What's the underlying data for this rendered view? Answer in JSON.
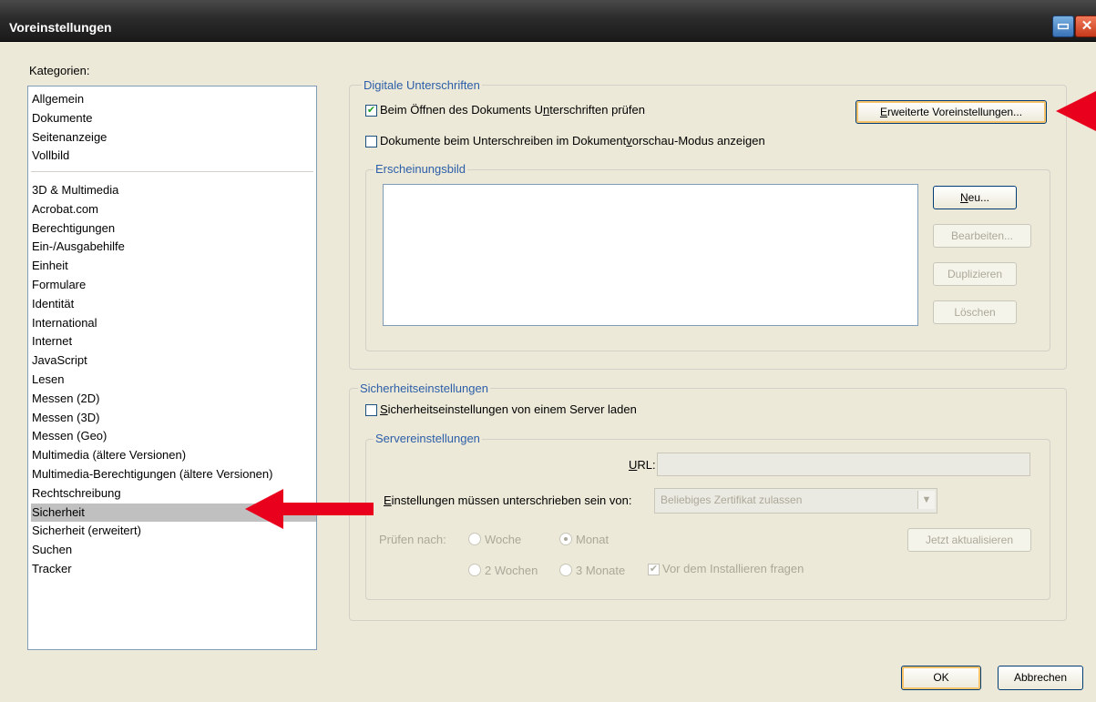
{
  "window": {
    "title": "Voreinstellungen"
  },
  "sidebar": {
    "label": "Kategorien:",
    "group1": [
      "Allgemein",
      "Dokumente",
      "Seitenanzeige",
      "Vollbild"
    ],
    "group2": [
      "3D & Multimedia",
      "Acrobat.com",
      "Berechtigungen",
      "Ein-/Ausgabehilfe",
      "Einheit",
      "Formulare",
      "Identität",
      "International",
      "Internet",
      "JavaScript",
      "Lesen",
      "Messen (2D)",
      "Messen (3D)",
      "Messen (Geo)",
      "Multimedia (ältere Versionen)",
      "Multimedia-Berechtigungen (ältere Versionen)",
      "Rechtschreibung",
      "Sicherheit",
      "Sicherheit (erweitert)",
      "Suchen",
      "Tracker"
    ],
    "selected": "Sicherheit"
  },
  "digital_signatures": {
    "title": "Digitale Unterschriften",
    "verify_on_open": {
      "label_pre": "Beim Öffnen des Dokuments U",
      "label_mnemonic": "n",
      "label_post": "terschriften prüfen",
      "checked": true
    },
    "advanced_button": {
      "mnemonic": "E",
      "label_post": "rweiterte Voreinstellungen..."
    },
    "preview_mode": {
      "label_pre": "Dokumente beim Unterschreiben im Dokument",
      "label_mnemonic": "v",
      "label_post": "orschau-Modus anzeigen",
      "checked": false
    },
    "appearance": {
      "title": "Erscheinungsbild",
      "new_button": {
        "mnemonic": "N",
        "label_post": "eu..."
      },
      "edit_button": "Bearbeiten...",
      "duplicate_button": "Duplizieren",
      "delete_button": "Löschen"
    }
  },
  "security_settings": {
    "title": "Sicherheitseinstellungen",
    "load_from_server": {
      "mnemonic": "S",
      "label_post": "icherheitseinstellungen von einem Server laden",
      "checked": false
    },
    "server": {
      "title": "Servereinstellungen",
      "url_label": {
        "mnemonic": "U",
        "label_post": "RL:"
      },
      "url_value": "",
      "signed_by_label": {
        "mnemonic": "E",
        "label_post": "instellungen müssen unterschrieben sein von:"
      },
      "signed_by_value": "Beliebiges Zertifikat zulassen",
      "check_label": "Prüfen nach:",
      "check_options": [
        "Woche",
        "Monat",
        "2 Wochen",
        "3 Monate"
      ],
      "check_selected": "Monat",
      "ask_before_install": {
        "label": "Vor dem Installieren fragen",
        "checked": true
      },
      "update_now_button": "Jetzt aktualisieren"
    }
  },
  "footer": {
    "ok": "OK",
    "cancel": "Abbrechen"
  },
  "colors": {
    "group_title": "#2c5ea8",
    "annotation_arrow": "#e8001c",
    "selection": "#c0c0c0"
  }
}
